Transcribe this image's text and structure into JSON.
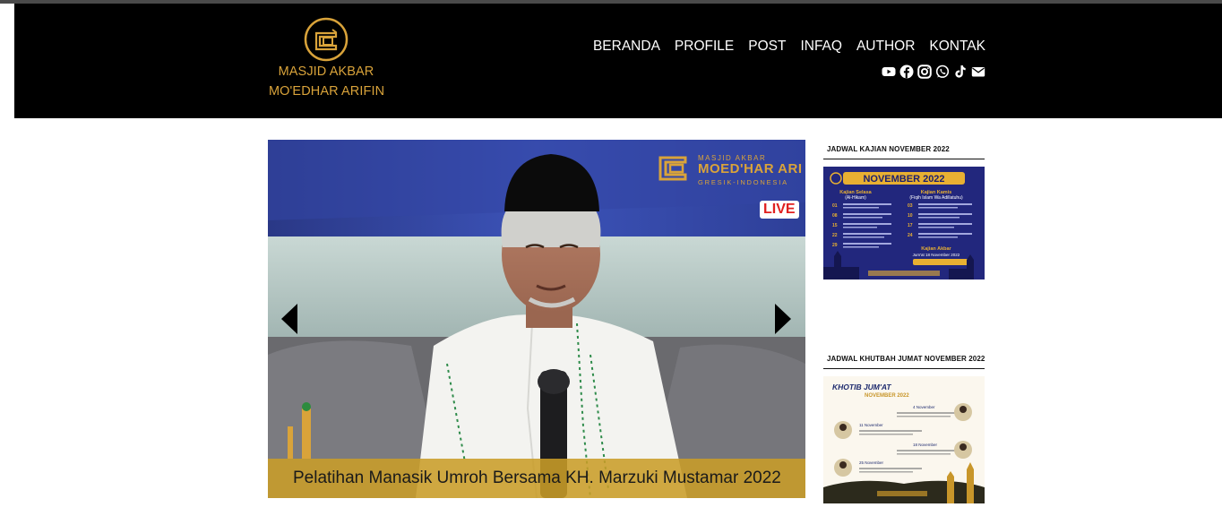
{
  "site": {
    "brand_line1": "MASJID AKBAR",
    "brand_line2": "MO'EDHAR ARIFIN"
  },
  "nav": {
    "items": [
      "BERANDA",
      "PROFILE",
      "POST",
      "INFAQ",
      "AUTHOR",
      "KONTAK"
    ]
  },
  "social_icons": [
    "youtube-icon",
    "facebook-icon",
    "instagram-icon",
    "whatsapp-icon",
    "tiktok-icon",
    "email-icon"
  ],
  "slider": {
    "caption": "Pelatihan Manasik Umroh Bersama KH. Marzuki Mustamar 2022",
    "live_badge": "LIVE",
    "overlay_small": "MASJID AKBAR",
    "overlay_big": "MOED'HAR ARI",
    "overlay_loc": "GRESIK-INDONESIA"
  },
  "sidebar": {
    "widget1_title": "JADWAL KAJIAN NOVEMBER 2022",
    "widget1_img": {
      "heading": "NOVEMBER 2022",
      "left_col": "Kajian Selasa",
      "left_sub": "(Al-Hikam)",
      "right_col": "Kajian Kamis",
      "right_sub": "(Fiqih Islam Wa Adillatuhu)",
      "dates_left": [
        "01",
        "08",
        "15",
        "22",
        "29"
      ],
      "dates_right": [
        "03",
        "10",
        "17",
        "24"
      ],
      "akbar": "Kajian Akbar",
      "akbar_date": "Jum'at 18 November 2022"
    },
    "widget2_title": "JADWAL KHUTBAH JUMAT NOVEMBER 2022",
    "widget2_img": {
      "heading1": "KHOTIB JUM'AT",
      "heading2": "NOVEMBER 2022",
      "entries": [
        "4 November",
        "11 November",
        "18 November",
        "25 November"
      ]
    }
  },
  "colors": {
    "gold": "#d9a33a",
    "header_bg": "#000000",
    "caption_bg": "#c99d28"
  }
}
